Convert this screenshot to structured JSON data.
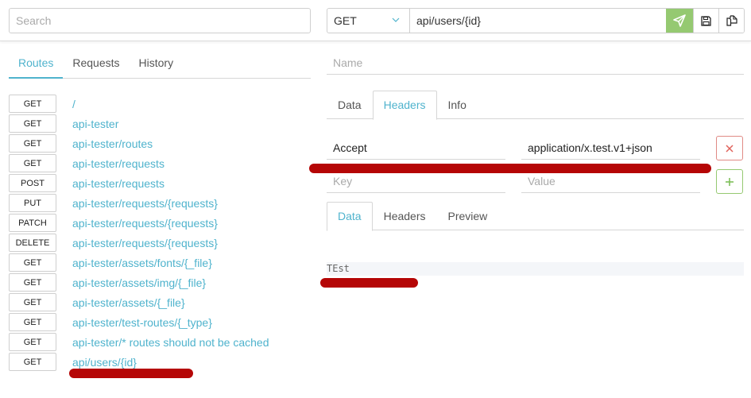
{
  "search": {
    "placeholder": "Search",
    "value": ""
  },
  "request": {
    "method": "GET",
    "url": "api/users/{id}",
    "send_icon": "paper-plane-icon",
    "save_icon": "floppy-disk-icon",
    "copy_icon": "copy-icon",
    "colors": {
      "send": "#95c971",
      "accent": "#4fb3cd",
      "delete": "#e08a85",
      "add": "#95c971"
    }
  },
  "left_tabs": [
    {
      "label": "Routes",
      "active": true
    },
    {
      "label": "Requests",
      "active": false
    },
    {
      "label": "History",
      "active": false
    }
  ],
  "routes": [
    {
      "method": "GET",
      "path": "/"
    },
    {
      "method": "GET",
      "path": "api-tester"
    },
    {
      "method": "GET",
      "path": "api-tester/routes"
    },
    {
      "method": "GET",
      "path": "api-tester/requests"
    },
    {
      "method": "POST",
      "path": "api-tester/requests"
    },
    {
      "method": "PUT",
      "path": "api-tester/requests/{requests}"
    },
    {
      "method": "PATCH",
      "path": "api-tester/requests/{requests}"
    },
    {
      "method": "DELETE",
      "path": "api-tester/requests/{requests}"
    },
    {
      "method": "GET",
      "path": "api-tester/assets/fonts/{_file}"
    },
    {
      "method": "GET",
      "path": "api-tester/assets/img/{_file}"
    },
    {
      "method": "GET",
      "path": "api-tester/assets/{_file}"
    },
    {
      "method": "GET",
      "path": "api-tester/test-routes/{_type}"
    },
    {
      "method": "GET",
      "path": "api-tester/* routes should not be cached"
    },
    {
      "method": "GET",
      "path": "api/users/{id}"
    }
  ],
  "name_field": {
    "placeholder": "Name",
    "value": ""
  },
  "request_tabs": [
    {
      "label": "Data",
      "active": false
    },
    {
      "label": "Headers",
      "active": true
    },
    {
      "label": "Info",
      "active": false
    }
  ],
  "headers": [
    {
      "key": "Accept",
      "value": "application/x.test.v1+json"
    }
  ],
  "new_header": {
    "key_placeholder": "Key",
    "value_placeholder": "Value"
  },
  "response_tabs": [
    {
      "label": "Data",
      "active": true
    },
    {
      "label": "Headers",
      "active": false
    },
    {
      "label": "Preview",
      "active": false
    }
  ],
  "response": {
    "body": "TEst"
  }
}
